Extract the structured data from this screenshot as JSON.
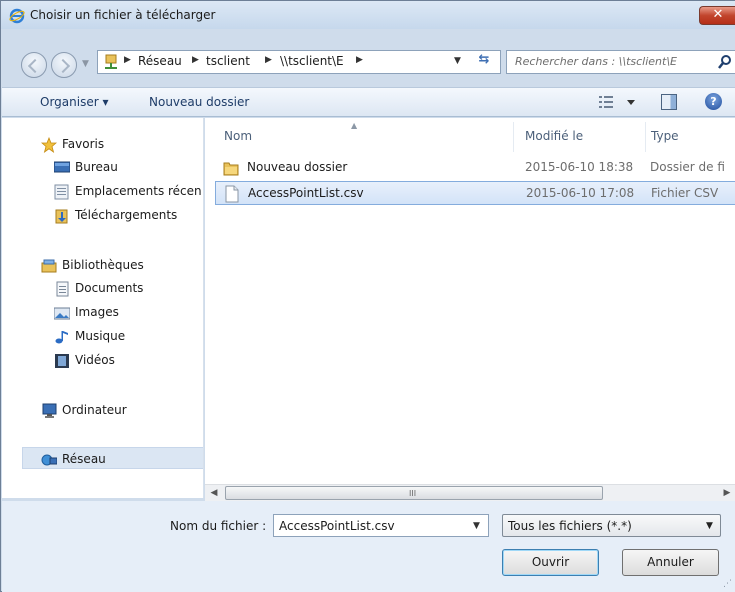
{
  "window": {
    "title": "Choisir un fichier à télécharger",
    "close_label": "✕"
  },
  "address": {
    "crumbs": [
      "Réseau",
      "tsclient",
      "\\\\tsclient\\E"
    ],
    "search_placeholder": "Rechercher dans : \\\\tsclient\\E"
  },
  "toolbar": {
    "organize_label": "Organiser ▾",
    "new_folder_label": "Nouveau dossier",
    "help_label": "?"
  },
  "sidebar": {
    "favorites_label": "Favoris",
    "favorites": [
      "Bureau",
      "Emplacements récen",
      "Téléchargements"
    ],
    "libraries_label": "Bibliothèques",
    "libraries": [
      "Documents",
      "Images",
      "Musique",
      "Vidéos"
    ],
    "computer_label": "Ordinateur",
    "network_label": "Réseau"
  },
  "filelist": {
    "columns": [
      "Nom",
      "Modifié le",
      "Type"
    ],
    "rows": [
      {
        "name": "Nouveau dossier",
        "date": "2015-06-10 18:38",
        "type": "Dossier de fi",
        "icon": "folder-icon"
      },
      {
        "name": "AccessPointList.csv",
        "date": "2015-06-10 17:08",
        "type": "Fichier CSV",
        "icon": "file-icon",
        "selected": true
      }
    ]
  },
  "scrollbar": {
    "grip": "III"
  },
  "footer": {
    "filename_label": "Nom du fichier :",
    "filename_value": "AccessPointList.csv",
    "filter_value": "Tous les fichiers (*.*)",
    "open_label": "Ouvrir",
    "cancel_label": "Annuler"
  },
  "colors": {
    "accent": "#3f6fb3",
    "selection": "#d3e3f8",
    "close": "#c2452d"
  }
}
